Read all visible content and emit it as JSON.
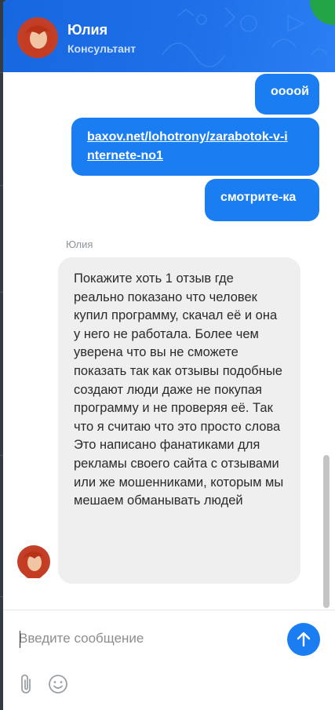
{
  "header": {
    "name": "Юлия",
    "role": "Консультант"
  },
  "messages": {
    "outgoing": [
      {
        "text": "оооой"
      },
      {
        "text": "baxov.net/lohotrony/zarabotok-v-internete-no1",
        "line1": "baxov.net/lohotrony/zarabotok-v-i",
        "line2": "nternete-no1"
      },
      {
        "text": "смотрите-ка"
      }
    ],
    "incoming": {
      "sender": "Юлия",
      "text": "Покажите хоть 1 отзыв где реально показано что человек купил программу, скачал её и она у него не работала. Более чем уверена что вы не сможете показать так как отзывы подобные создают люди даже не покупая программу и не проверяя её. Так что я считаю что это просто слова\nЭто написано фанатиками для рекламы своего сайта с отзывами или же мошенниками, которым мы мешаем обманывать людей"
    }
  },
  "input": {
    "placeholder": "Введите сообщение",
    "value": ""
  },
  "icons": {
    "send": "arrow-up-icon",
    "attach": "paperclip-icon",
    "emoji": "smiley-icon"
  },
  "colors": {
    "accent": "#1a7ef2",
    "header": "#1f6fe8",
    "incoming_bubble": "#efefef"
  }
}
